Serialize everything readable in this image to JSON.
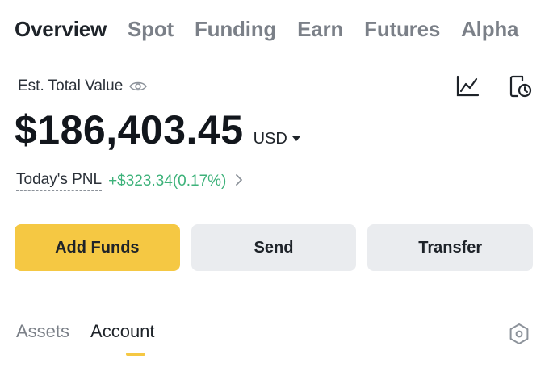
{
  "top_tabs": [
    {
      "label": "Overview",
      "active": true
    },
    {
      "label": "Spot",
      "active": false
    },
    {
      "label": "Funding",
      "active": false
    },
    {
      "label": "Earn",
      "active": false
    },
    {
      "label": "Futures",
      "active": false
    },
    {
      "label": "Alpha",
      "active": false
    }
  ],
  "balance": {
    "label": "Est. Total Value",
    "amount": "$186,403.45",
    "currency": "USD",
    "pnl_label": "Today's PNL",
    "pnl_value": "+$323.34(0.17%)"
  },
  "actions": {
    "add_funds": "Add Funds",
    "send": "Send",
    "transfer": "Transfer"
  },
  "bottom_tabs": [
    {
      "label": "Assets",
      "active": false
    },
    {
      "label": "Account",
      "active": true
    }
  ],
  "icons": {
    "visibility": "eye-icon",
    "chart": "line-chart-icon",
    "history": "history-icon",
    "settings": "hexagon-settings-icon"
  },
  "colors": {
    "accent": "#f5c843",
    "positive": "#3db27a",
    "secondary_button": "#eaecef"
  }
}
